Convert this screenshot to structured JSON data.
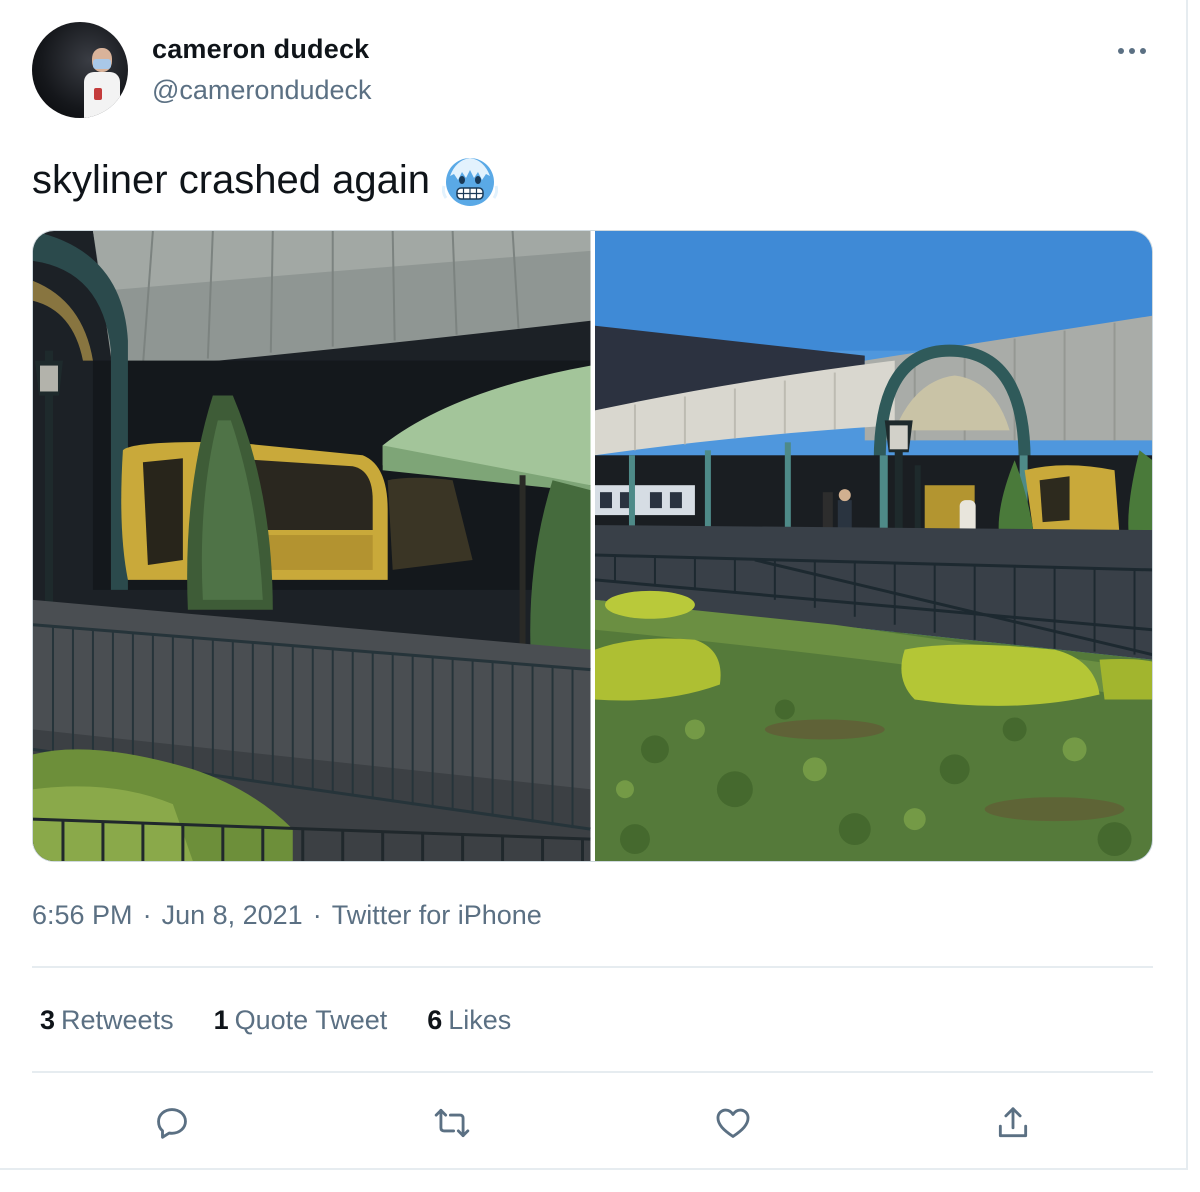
{
  "author": {
    "display_name": "cameron dudeck",
    "handle": "@camerondudeck"
  },
  "tweet": {
    "text": "skyliner crashed again",
    "emoji": "cold-face-emoji"
  },
  "meta": {
    "time": "6:56 PM",
    "separator": "·",
    "date": "Jun 8, 2021",
    "source": "Twitter for iPhone"
  },
  "stats": {
    "retweets_count": "3",
    "retweets_label": "Retweets",
    "quotes_count": "1",
    "quotes_label": "Quote Tweet",
    "likes_count": "6",
    "likes_label": "Likes"
  },
  "icons": {
    "more": "more-dots-icon",
    "reply": "reply-icon",
    "retweet": "retweet-icon",
    "like": "like-icon",
    "share": "share-icon"
  },
  "colors": {
    "text_primary": "#0f1419",
    "text_secondary": "#5b7083",
    "border": "#e6ecf0",
    "emoji_blue": "#5aa9e6"
  }
}
